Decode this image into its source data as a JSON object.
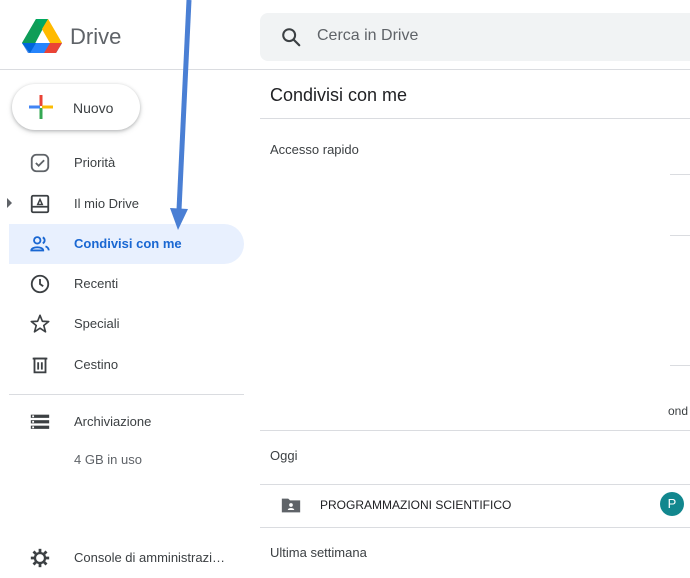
{
  "header": {
    "app_name": "Drive",
    "search": {
      "placeholder": "Cerca in Drive",
      "icon": "search-icon"
    }
  },
  "sidebar": {
    "new_button_label": "Nuovo",
    "items": [
      {
        "label": "Priorità",
        "icon": "priority-check-icon",
        "active": false
      },
      {
        "label": "Il mio Drive",
        "icon": "my-drive-icon",
        "active": false,
        "expandable": true
      },
      {
        "label": "Condivisi con me",
        "icon": "shared-people-icon",
        "active": true
      },
      {
        "label": "Recenti",
        "icon": "clock-icon",
        "active": false
      },
      {
        "label": "Speciali",
        "icon": "star-icon",
        "active": false
      },
      {
        "label": "Cestino",
        "icon": "trash-icon",
        "active": false
      }
    ],
    "storage": {
      "label": "Archiviazione",
      "usage": "4 GB in uso",
      "icon": "storage-icon"
    },
    "admin_console": {
      "label": "Console di amministrazi…",
      "icon": "settings-gear-icon"
    }
  },
  "main": {
    "title": "Condivisi con me",
    "quick_access_label": "Accesso rapido",
    "clipped_text": "ond",
    "sections": [
      {
        "label": "Oggi"
      },
      {
        "label": "Ultima settimana"
      }
    ],
    "files": [
      {
        "name": "PROGRAMMAZIONI SCIENTIFICO",
        "type": "shared-folder",
        "owner_initial": "P",
        "owner_color": "#12878e"
      }
    ]
  },
  "colors": {
    "accent": "#1967d2",
    "active_bg": "#e8f0fe",
    "annotation_arrow": "#4a7fd4"
  }
}
